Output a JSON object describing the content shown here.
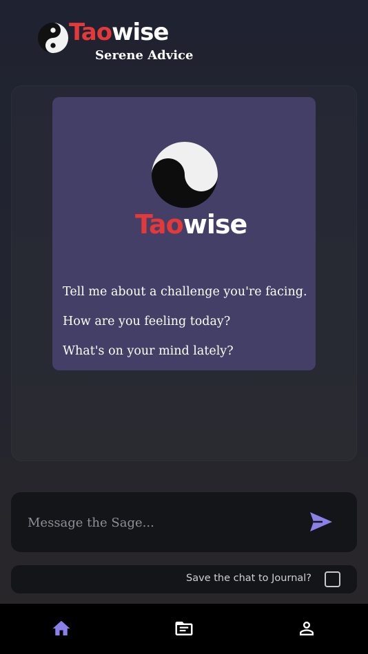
{
  "header": {
    "brand_part1": "Tao",
    "brand_part2": "wise",
    "subtitle": "Serene Advice"
  },
  "welcome_card": {
    "brand_part1": "Tao",
    "brand_part2": "wise",
    "prompts": [
      "Tell me about a challenge you're facing.",
      "How are you feeling today?",
      "What's on your mind lately?"
    ]
  },
  "composer": {
    "placeholder": "Message the Sage...",
    "send_icon": "send-icon"
  },
  "journal": {
    "label": "Save the chat to Journal?",
    "checked": false
  },
  "nav": {
    "items": [
      {
        "icon": "home-icon",
        "active": true
      },
      {
        "icon": "journal-icon",
        "active": false
      },
      {
        "icon": "profile-icon",
        "active": false
      }
    ]
  },
  "colors": {
    "accent": "#8b7fe8",
    "brand_red": "#e23a3a",
    "card_bg": "#443f66",
    "panel_bg": "#141519"
  }
}
